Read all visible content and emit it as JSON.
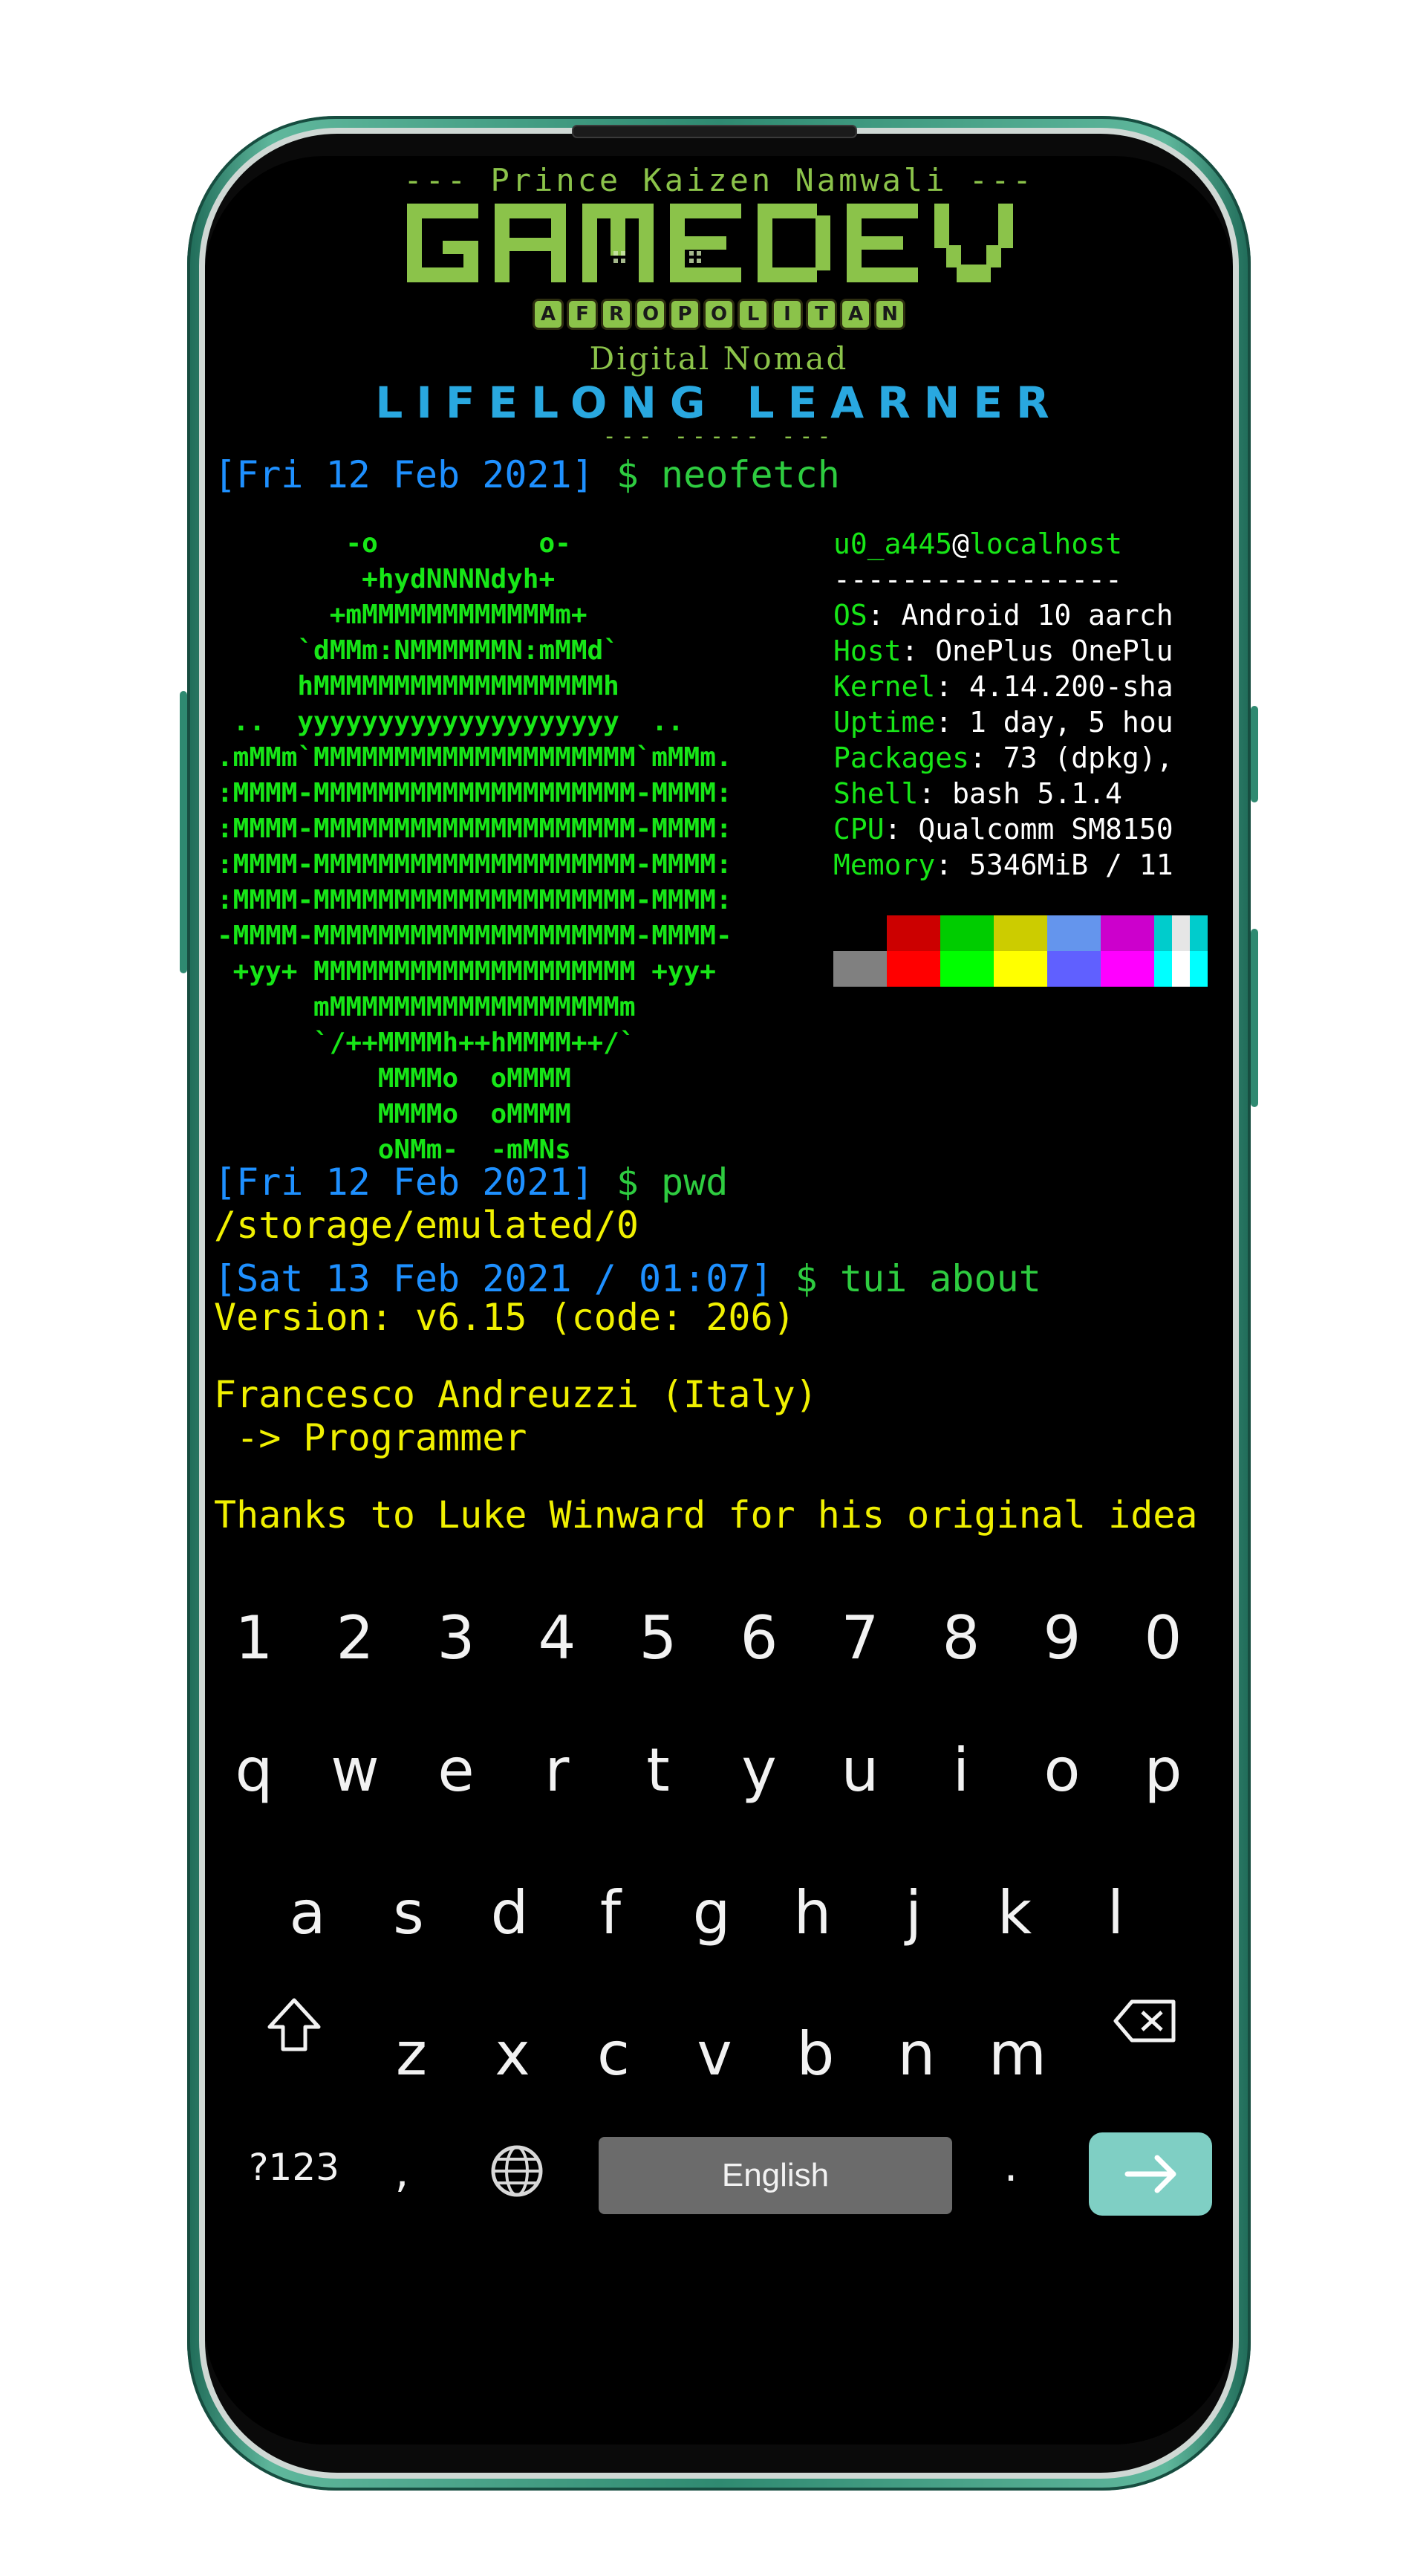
{
  "banner": {
    "author_line": "--- Prince Kaizen Namwali  ---",
    "logo_text": "GAMEDEV",
    "afropolitan_letters": [
      "A",
      "F",
      "R",
      "O",
      "P",
      "O",
      "L",
      "I",
      "T",
      "A",
      "N"
    ],
    "nomad": "Digital Nomad",
    "lifelong": "LIFELONG LEARNER",
    "dashes": "--- ----- ---"
  },
  "terminal": {
    "prompt1": {
      "date": "[Fri 12 Feb 2021]",
      "cmd": " $ neofetch"
    },
    "ascii_art": "        -o          o-\n         +hydNNNNdyh+\n       +mMMMMMMMMMMMMm+\n     `dMMm:NMMMMMMN:mMMd`\n     hMMMMMMMMMMMMMMMMMMh\n ..  yyyyyyyyyyyyyyyyyyyy  ..\n.mMMm`MMMMMMMMMMMMMMMMMMMM`mMMm.\n:MMMM-MMMMMMMMMMMMMMMMMMMM-MMMM:\n:MMMM-MMMMMMMMMMMMMMMMMMMM-MMMM:\n:MMMM-MMMMMMMMMMMMMMMMMMMM-MMMM:\n:MMMM-MMMMMMMMMMMMMMMMMMMM-MMMM:\n-MMMM-MMMMMMMMMMMMMMMMMMMM-MMMM-\n +yy+ MMMMMMMMMMMMMMMMMMMM +yy+\n      mMMMMMMMMMMMMMMMMMMm\n      `/++MMMMh++hMMMM++/`\n          MMMMo  oMMMM\n          MMMMo  oMMMM\n          oNMm-  -mMNs",
    "info": {
      "user": "u0_a445",
      "at": "@",
      "host": "localhost",
      "separator": "-----------------",
      "rows": [
        {
          "key": "OS",
          "val": ": Android 10 aarch"
        },
        {
          "key": "Host",
          "val": ": OnePlus OnePlu"
        },
        {
          "key": "Kernel",
          "val": ": 4.14.200-sha"
        },
        {
          "key": "Uptime",
          "val": ": 1 day, 5 hou"
        },
        {
          "key": "Packages",
          "val": ": 73 (dpkg),"
        },
        {
          "key": "Shell",
          "val": ": bash 5.1.4"
        },
        {
          "key": "CPU",
          "val": ": Qualcomm SM8150"
        },
        {
          "key": "Memory",
          "val": ": 5346MiB / 11"
        }
      ]
    },
    "palette_top": [
      "#000000",
      "#cc0000",
      "#00cc00",
      "#cccc00",
      "#6495ed",
      "#cc00cc",
      "#00cccc",
      "#e6e6e6"
    ],
    "palette_bottom": [
      "#808080",
      "#ff0000",
      "#00ff00",
      "#ffff00",
      "#6060ff",
      "#ff00ff",
      "#00ffff",
      "#ffffff"
    ],
    "prompt2": {
      "date": "[Fri 12 Feb 2021]",
      "cmd": " $ pwd"
    },
    "pwd_output": "/storage/emulated/0",
    "prompt3": {
      "date": "[Sat 13 Feb 2021 / 01:07]",
      "cmd": " $ tui about"
    },
    "version": "Version: v6.15 (code: 206)",
    "author": "Francesco Andreuzzi (Italy)",
    "role": " -> Programmer",
    "thanks": "Thanks to Luke Winward for his original idea"
  },
  "keyboard": {
    "numbers": [
      "1",
      "2",
      "3",
      "4",
      "5",
      "6",
      "7",
      "8",
      "9",
      "0"
    ],
    "row1": [
      "q",
      "w",
      "e",
      "r",
      "t",
      "y",
      "u",
      "i",
      "o",
      "p"
    ],
    "row2": [
      "a",
      "s",
      "d",
      "f",
      "g",
      "h",
      "j",
      "k",
      "l"
    ],
    "row3": [
      "z",
      "x",
      "c",
      "v",
      "b",
      "n",
      "m"
    ],
    "symbols_key": "?123",
    "comma_key": ",",
    "space_label": "English",
    "period_key": "."
  }
}
